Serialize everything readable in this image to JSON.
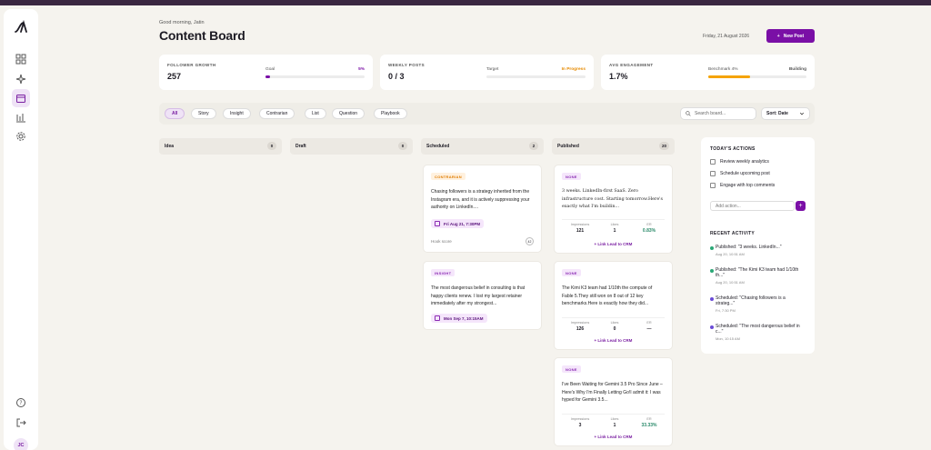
{
  "header": {
    "greeting": "Good morning, Jatin",
    "title": "Content Board",
    "date": "Friday, 21 August 2026",
    "new_post_label": "New Post"
  },
  "metrics": [
    {
      "label": "FOLLOWER GROWTH",
      "value": "257",
      "sub_label": "Goal",
      "sub_value": "5%",
      "progress": 0.05,
      "color": "#7a0fa6"
    },
    {
      "label": "WEEKLY POSTS",
      "value": "0 / 3",
      "sub_label": "Target",
      "sub_value": "In Progress",
      "progress": 0.0,
      "color": "#e68a00"
    },
    {
      "label": "AVG ENGAGEMENT",
      "value": "1.7%",
      "sub_label": "Benchmark 4%",
      "sub_value": "Building",
      "progress": 0.43,
      "color": "#f5a300"
    }
  ],
  "filters": [
    "All",
    "Story",
    "Insight",
    "Contrarian",
    "List",
    "Question",
    "Playbook"
  ],
  "search": {
    "placeholder": "Search board..."
  },
  "sort": {
    "label": "Sort: Date"
  },
  "columns": [
    {
      "name": "Idea",
      "count": "0"
    },
    {
      "name": "Draft",
      "count": "0"
    },
    {
      "name": "Scheduled",
      "count": "2"
    },
    {
      "name": "Published",
      "count": "20"
    }
  ],
  "scheduled": [
    {
      "tag": "CONTRARIAN",
      "text": "Chasing followers is a strategy inherited from the Instagram era, and it is actively suppressing your authority on LinkedIn....",
      "date": "Fri Aug 21, 7:30PM",
      "hook_label": "Hook score",
      "hook_value": "42"
    },
    {
      "tag": "INSIGHT",
      "text": "The most dangerous belief in consulting is that happy clients renew. I lost my largest retainer immediately after my strongest...",
      "date": "Mon Sep 7, 10:15AM"
    }
  ],
  "published": [
    {
      "tag": "NONE",
      "text": "3 weeks. LinkedIn-first SaaS. Zero infrastructure cost. Starting tomorrow.Here's exactly what I'm buildin...",
      "impressions": "121",
      "likes": "1",
      "er": "0.83%",
      "lead": "+ Link Lead to CRM"
    },
    {
      "tag": "NONE",
      "text": "The Kimi K3 team had 1/10th the compute of Fable 5.They still won on 8 out of 12 key benchmarks.Here is exactly how they did...",
      "impressions": "126",
      "likes": "0",
      "er": "—",
      "lead": "+ Link Lead to CRM"
    },
    {
      "tag": "NONE",
      "text": "I've Been Waiting for Gemini 3.5 Pro Since June – Here's Why I'm Finally Letting Go!I admit it: I was hyped for Gemini 3.5...",
      "impressions": "3",
      "likes": "1",
      "er": "33.33%",
      "lead": "+ Link Lead to CRM"
    }
  ],
  "stat_labels": {
    "impressions": "Impressions",
    "likes": "Likes",
    "er": "ER"
  },
  "actions_panel": {
    "title": "TODAY'S ACTIONS",
    "items": [
      "Review weekly analytics",
      "Schedule upcoming post",
      "Engage with top comments"
    ],
    "add_placeholder": "Add action...",
    "add_label": "+",
    "activity_title": "RECENT ACTIVITY",
    "activity": [
      {
        "text": "Published: \"3 weeks. LinkedIn...\"",
        "time": "Aug 20, 10:51 AM",
        "color": "#2aa876"
      },
      {
        "text": "Published: \"The Kimi K3 team had 1/10th th...\"",
        "time": "Aug 20, 10:51 AM",
        "color": "#2aa876"
      },
      {
        "text": "Scheduled: \"Chasing followers is a strateg...\"",
        "time": "Fri, 7:30 PM",
        "color": "#6a4bd6"
      },
      {
        "text": "Scheduled: \"The most dangerous belief in c...\"",
        "time": "Mon, 10:15 AM",
        "color": "#6a4bd6"
      }
    ]
  },
  "user": {
    "initials": "JC"
  }
}
